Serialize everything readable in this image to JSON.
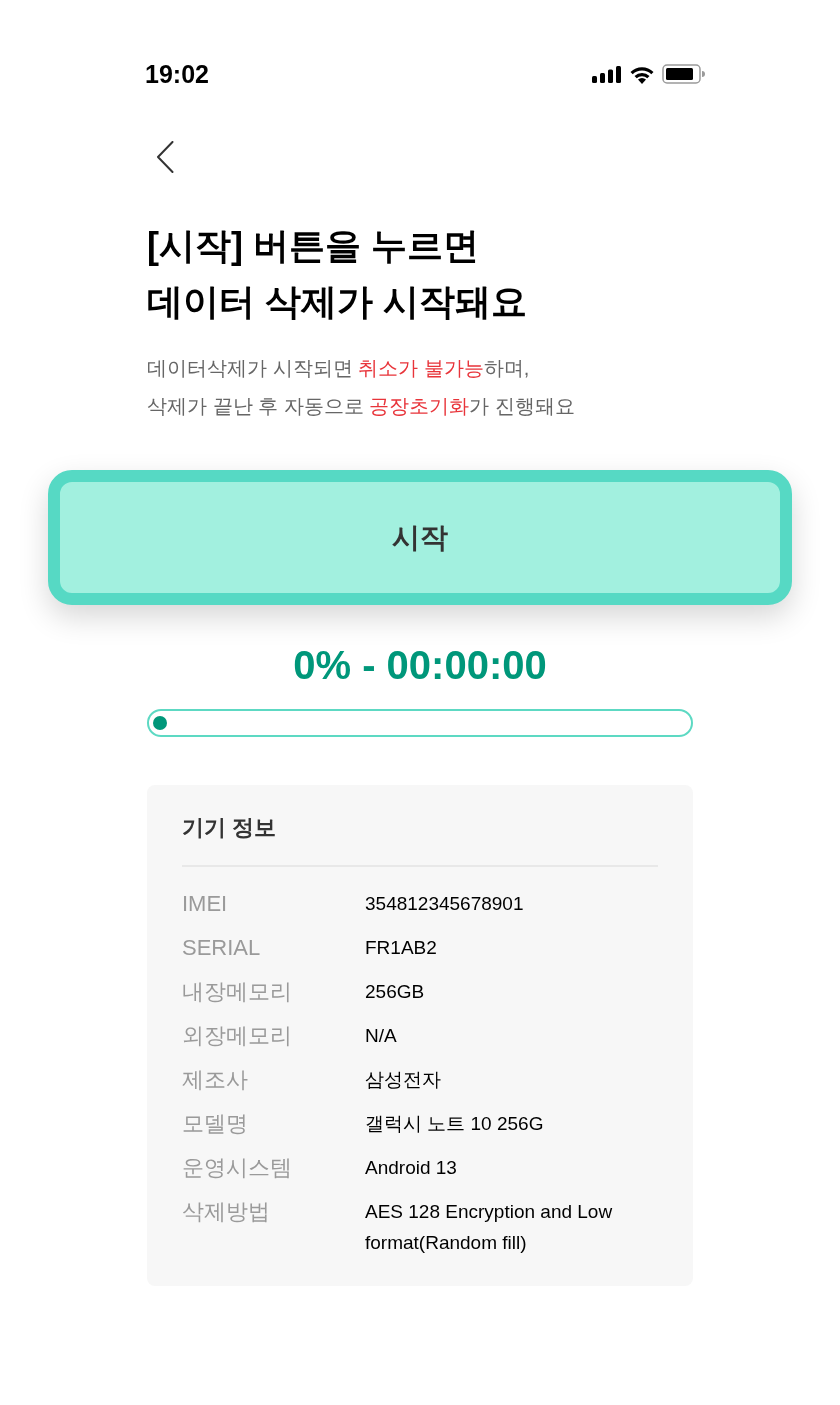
{
  "status_bar": {
    "time": "19:02"
  },
  "header": {
    "title_lines": [
      "[시작] 버튼을 누르면",
      "데이터 삭제가 시작돼요"
    ]
  },
  "notice": {
    "lines": [
      [
        {
          "text": "데이터삭제가 시작되면 ",
          "kind": "plain"
        },
        {
          "text": "취소가 불가능",
          "kind": "warning"
        },
        {
          "text": "하며,",
          "kind": "plain"
        }
      ],
      [
        {
          "text": "삭제가 끝난 후 자동으로 ",
          "kind": "plain"
        },
        {
          "text": "공장초기화",
          "kind": "warning"
        },
        {
          "text": "가 진행돼요",
          "kind": "plain"
        }
      ]
    ]
  },
  "start_button": {
    "label": "시작"
  },
  "progress": {
    "reading": "0% - 00:00:00",
    "level": 0
  },
  "device_info": {
    "title": "기기 정보",
    "rows": [
      {
        "label": "IMEI",
        "value": "354812345678901"
      },
      {
        "label": "SERIAL",
        "value": "FR1AB2"
      },
      {
        "label": "내장메모리",
        "value": "256GB"
      },
      {
        "label": "외장메모리",
        "value": "N/A"
      },
      {
        "label": "제조사",
        "value": "삼성전자"
      },
      {
        "label": "모델명",
        "value": "갤럭시 노트 10 256G"
      },
      {
        "label": "운영시스템",
        "value": "Android 13"
      },
      {
        "label": "삭제방법",
        "value": "AES 128 Encryption and Low format(Random fill)"
      }
    ]
  }
}
